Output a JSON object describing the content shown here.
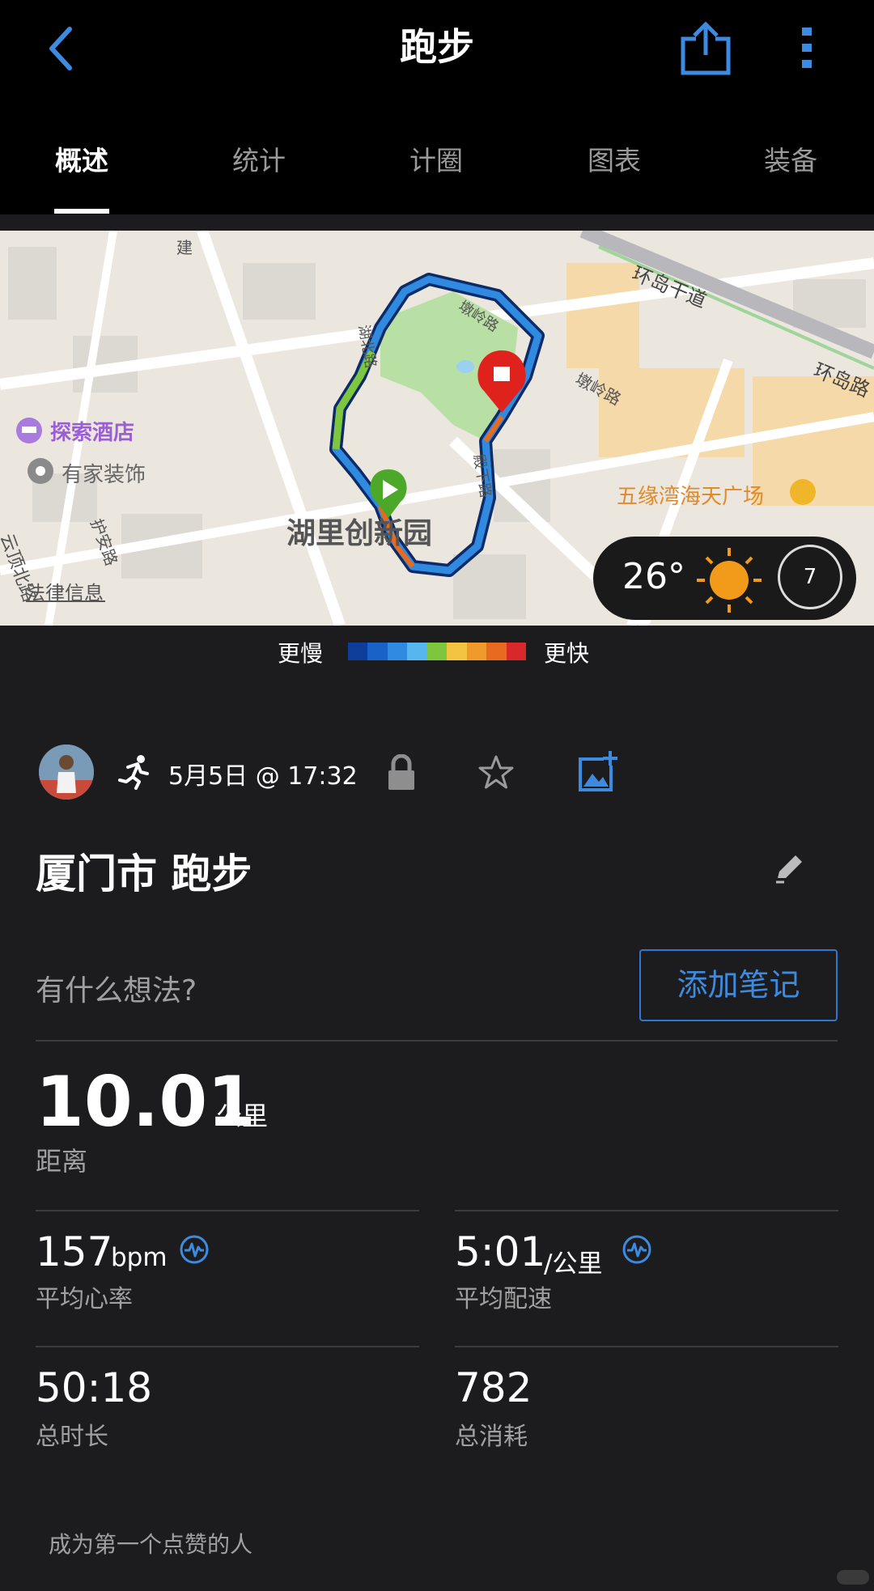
{
  "header": {
    "title": "跑步",
    "tabs": [
      {
        "label": "概述",
        "active": true
      },
      {
        "label": "统计",
        "active": false
      },
      {
        "label": "计圈",
        "active": false
      },
      {
        "label": "图表",
        "active": false
      },
      {
        "label": "装备",
        "active": false
      }
    ]
  },
  "map": {
    "labels": {
      "poi_hotel": "探索酒店",
      "poi_deco": "有家装饰",
      "park": "湖里创新园",
      "mall": "五缘湾海天广场",
      "road_huandao": "环岛干道",
      "road_huandao2": "环岛路",
      "road_dunling": "墩岭路",
      "road_dunling2": "墩岭路",
      "road_huan": "护安路",
      "road_yundingbei": "云顶北路",
      "road_jian": "建",
      "road_west": "湖北路",
      "road_east": "殿下路",
      "legal": "法律信息"
    },
    "weather": {
      "temperature": "26°",
      "wind": "7"
    }
  },
  "legend": {
    "slower": "更慢",
    "faster": "更快",
    "colors": [
      "#0d3f9a",
      "#1862c8",
      "#2f8ae0",
      "#58b6ee",
      "#7ec63d",
      "#f2c441",
      "#f09a2c",
      "#e86a1e",
      "#d8282a"
    ]
  },
  "activity": {
    "date": "5月5日 @ 17:32",
    "title": "厦门市 跑步",
    "thoughts_placeholder": "有什么想法?",
    "add_note": "添加笔记"
  },
  "stats": {
    "distance": {
      "value": "10.01",
      "unit": "公里",
      "label": "距离"
    },
    "avg_hr": {
      "value": "157",
      "unit": "bpm",
      "label": "平均心率"
    },
    "avg_pace": {
      "value": "5:01",
      "unit": "/公里",
      "label": "平均配速"
    },
    "total_time": {
      "value": "50:18",
      "label": "总时长"
    },
    "calories": {
      "value": "782",
      "label": "总消耗"
    }
  },
  "social": {
    "likes_text": "成为第一个点赞的人"
  },
  "colors": {
    "accent": "#3d8be0",
    "background": "#1c1c1e",
    "header": "#000000"
  }
}
